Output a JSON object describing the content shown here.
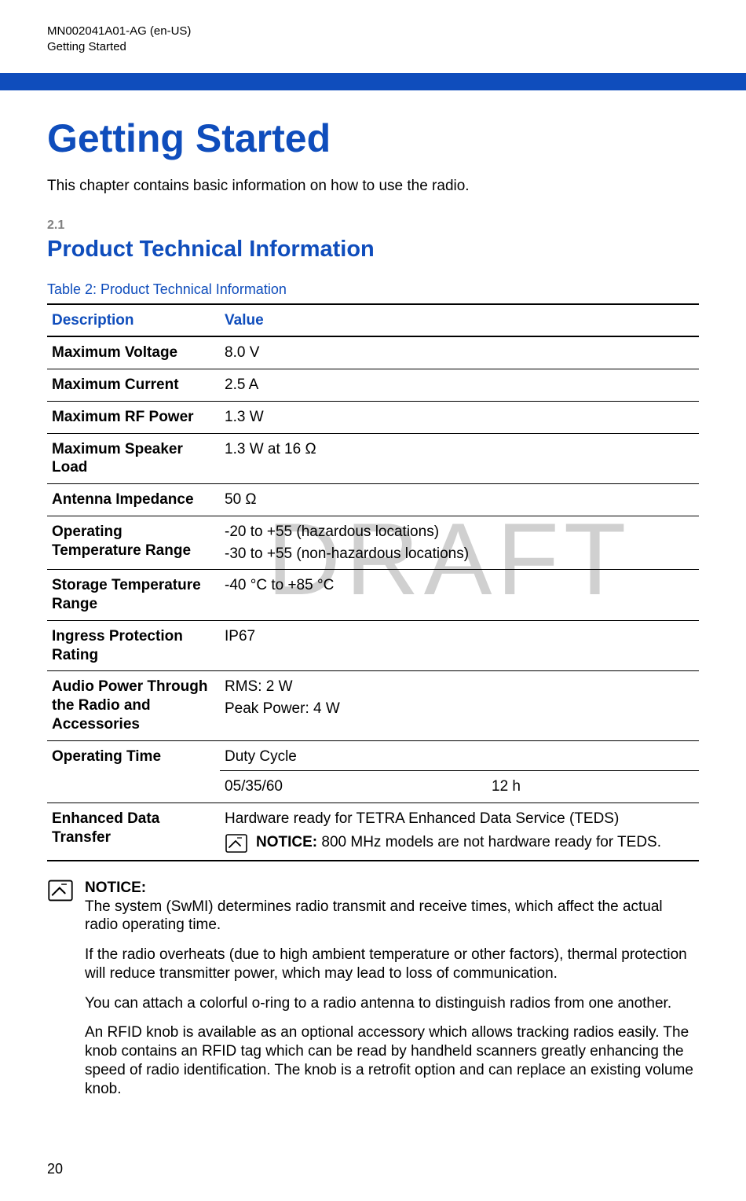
{
  "header": {
    "doc_id": "MN002041A01-AG (en-US)",
    "section": "Getting Started"
  },
  "chapter": {
    "title": "Getting Started",
    "intro": "This chapter contains basic information on how to use the radio."
  },
  "section": {
    "num": "2.1",
    "title": "Product Technical Information"
  },
  "table": {
    "caption": "Table 2: Product Technical Information",
    "col1": "Description",
    "col2": "Value",
    "rows": {
      "r0": {
        "desc": "Maximum Voltage",
        "val": "8.0 V"
      },
      "r1": {
        "desc": "Maximum Current",
        "val": "2.5 A"
      },
      "r2": {
        "desc": "Maximum RF Power",
        "val": "1.3 W"
      },
      "r3": {
        "desc": "Maximum Speaker Load",
        "val": "1.3 W at 16 Ω"
      },
      "r4": {
        "desc": "Antenna Impedance",
        "val": "50 Ω"
      },
      "r5": {
        "desc": "Operating Temperature Range",
        "val1": "-20 to +55 (hazardous locations)",
        "val2": "-30 to +55 (non-hazardous locations)"
      },
      "r6": {
        "desc": "Storage Temperature Range",
        "val": "-40 °C to +85 °C"
      },
      "r7": {
        "desc": "Ingress Protection Rating",
        "val": "IP67"
      },
      "r8": {
        "desc": "Audio Power Through the Radio and Accessories",
        "val1": "RMS: 2 W",
        "val2": "Peak Power: 4 W"
      },
      "r9": {
        "desc": "Operating Time",
        "val": "Duty Cycle",
        "sub_left": "05/35/60",
        "sub_right": "12 h"
      },
      "r10": {
        "desc": "Enhanced Data Transfer",
        "val": "Hardware ready for TETRA Enhanced Data Service (TEDS)",
        "notice_label": "NOTICE:",
        "notice_text": " 800 MHz models are not hardware ready for TEDS."
      }
    }
  },
  "notice": {
    "label": "NOTICE:",
    "p1": "The system (SwMI) determines radio transmit and receive times, which affect the actual radio operating time.",
    "p2": "If the radio overheats (due to high ambient temperature or other factors), thermal protection will reduce transmitter power, which may lead to loss of communication.",
    "p3": "You can attach a colorful o-ring to a radio antenna to distinguish radios from one another.",
    "p4": "An RFID knob is available as an optional accessory which allows tracking radios easily. The knob contains an RFID tag which can be read by handheld scanners greatly enhancing the speed of radio identification. The knob is a retrofit option and can replace an existing volume knob."
  },
  "watermark": "DRAFT",
  "page_num": "20"
}
